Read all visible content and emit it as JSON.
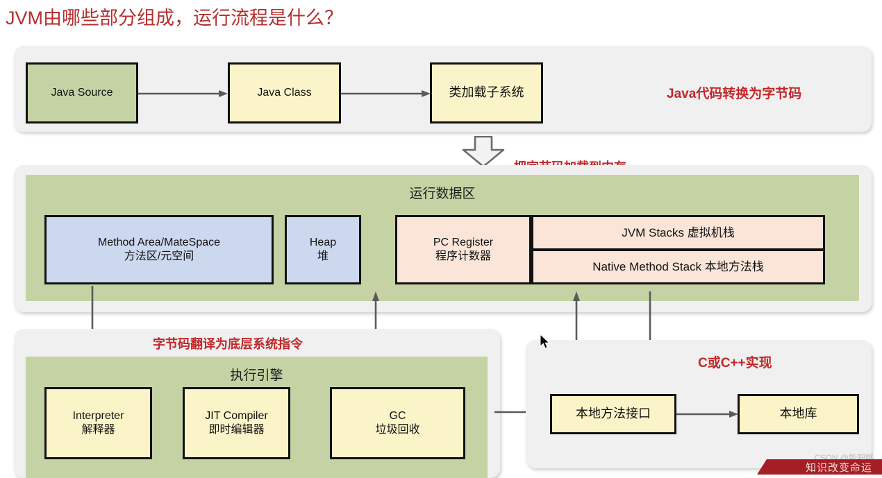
{
  "page": {
    "title": "JVM由哪些部分组成，运行流程是什么？",
    "title_color": "#b5302f",
    "background": "#ffffff"
  },
  "colors": {
    "panel_bg": "#f0f0f0",
    "green": "#c5d3a4",
    "yellow": "#faf4c8",
    "blue": "#ccd8ee",
    "peach": "#fae5d8",
    "box_border": "#111111",
    "arrow": "#5a5a5a",
    "note_red": "#c0282a"
  },
  "compile_panel": {
    "boxes": [
      {
        "label": "Java Source",
        "fill": "green"
      },
      {
        "label": "Java Class",
        "fill": "yellow"
      },
      {
        "label": "类加载子系统",
        "fill": "yellow"
      }
    ],
    "note": "Java代码转换为字节码"
  },
  "load_note": "把字节码加载到内存",
  "runtime_panel": {
    "band_title": "运行数据区",
    "method_area": {
      "line1": "Method Area/MateSpace",
      "line2": "方法区/元空间",
      "fill": "blue"
    },
    "heap": {
      "line1": "Heap",
      "line2": "堆",
      "fill": "blue"
    },
    "pc_register": {
      "line1": "PC Register",
      "line2": "程序计数器",
      "fill": "peach"
    },
    "jvm_stacks": {
      "line1": "JVM Stacks 虚拟机栈",
      "fill": "peach"
    },
    "native_method_stack": {
      "line1": "Native Method Stack 本地方法栈",
      "fill": "peach"
    }
  },
  "engine_panel": {
    "note": "字节码翻译为底层系统指令",
    "band_title": "执行引擎",
    "boxes": [
      {
        "line1": "Interpreter",
        "line2": "解释器",
        "fill": "yellow"
      },
      {
        "line1": "JIT Compiler",
        "line2": "即时编辑器",
        "fill": "yellow"
      },
      {
        "line1": "GC",
        "line2": "垃圾回收",
        "fill": "yellow"
      }
    ]
  },
  "native_panel": {
    "note": "C或C++实现",
    "boxes": [
      {
        "label": "本地方法接口",
        "fill": "yellow"
      },
      {
        "label": "本地库",
        "fill": "yellow"
      }
    ]
  },
  "watermark": {
    "text": "CSDN @能吧够",
    "ribbon_text": "知识改变命运"
  }
}
